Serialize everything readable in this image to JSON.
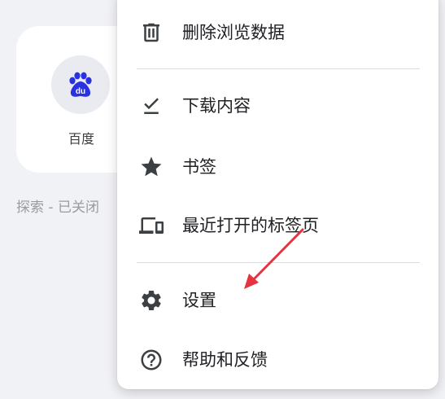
{
  "background": {
    "shortcut": {
      "label": "百度",
      "icon": "baidu-paw-icon"
    },
    "discover_label": "探索 - 已关闭"
  },
  "menu": {
    "items": [
      {
        "label": "删除浏览数据",
        "icon": "trash-icon"
      },
      {
        "label": "下载内容",
        "icon": "download-check-icon"
      },
      {
        "label": "书签",
        "icon": "star-icon"
      },
      {
        "label": "最近打开的标签页",
        "icon": "devices-icon"
      },
      {
        "label": "设置",
        "icon": "gear-icon"
      },
      {
        "label": "帮助和反馈",
        "icon": "help-icon"
      }
    ]
  },
  "colors": {
    "background": "#f1f2f5",
    "icon": "#3c4043",
    "annotation": "#e5333f",
    "baidu_blue": "#2932e1"
  }
}
